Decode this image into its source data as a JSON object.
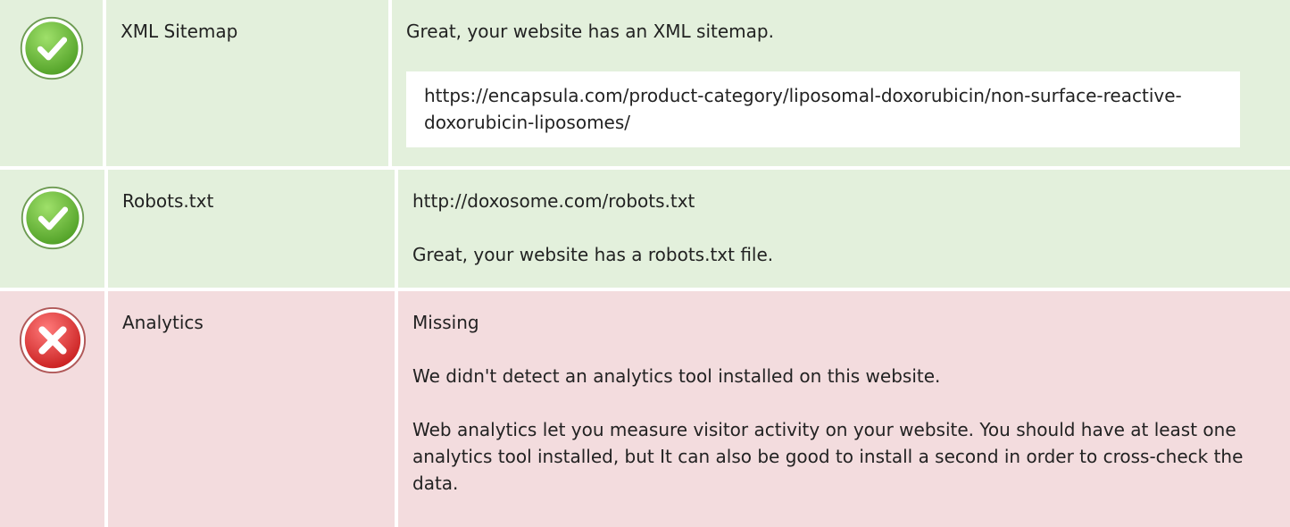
{
  "rows": [
    {
      "status": "pass",
      "icon": "check-circle-icon",
      "name": "XML Sitemap",
      "details": [
        "Great, your website has an XML sitemap."
      ],
      "url": "https://encapsula.com/product-category/liposomal-doxorubicin/non-surface-reactive-doxorubicin-liposomes/"
    },
    {
      "status": "pass",
      "icon": "check-circle-icon",
      "name": "Robots.txt",
      "details": [
        "http://doxosome.com/robots.txt",
        "Great, your website has a robots.txt file."
      ]
    },
    {
      "status": "fail",
      "icon": "x-circle-icon",
      "name": "Analytics",
      "details": [
        "Missing",
        "We didn't detect an analytics tool installed on this website.",
        "Web analytics let you measure visitor activity on your website. You should have at least one analytics tool installed, but It can also be good to install a second in order to cross-check the data."
      ]
    }
  ],
  "colors": {
    "pass_background": "#e3f0dc",
    "fail_background": "#f3dcde",
    "pass_icon": "#6fbf3f",
    "fail_icon": "#e23b3b"
  }
}
